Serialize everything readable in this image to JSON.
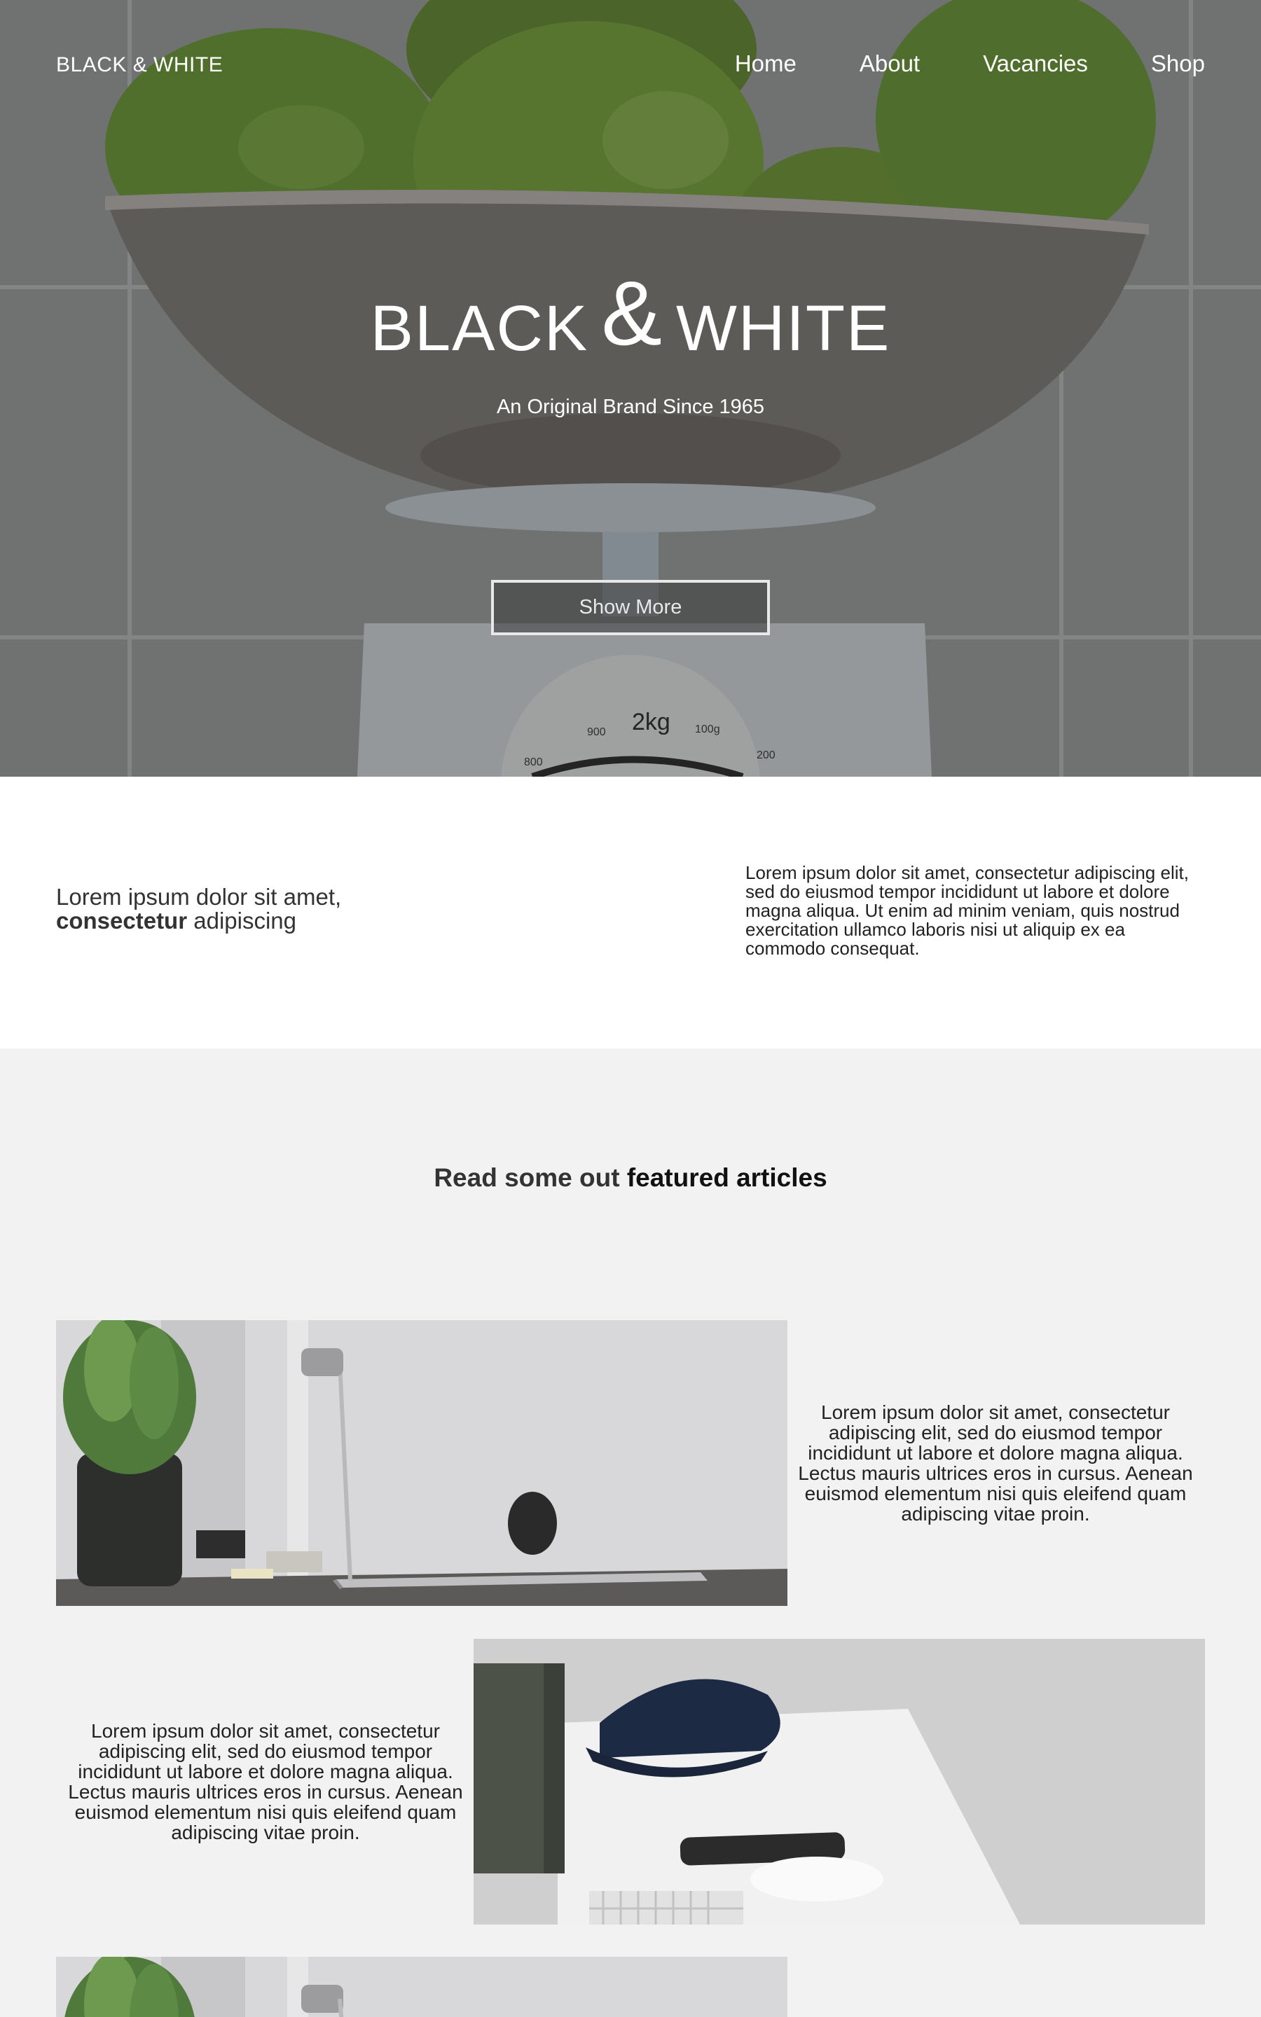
{
  "nav": {
    "brand": "BLACK & WHITE",
    "items": [
      {
        "label": "Home"
      },
      {
        "label": "About"
      },
      {
        "label": "Vacancies"
      },
      {
        "label": "Shop"
      }
    ]
  },
  "hero": {
    "title_left": "BLACK",
    "title_amp": "&",
    "title_right": "WHITE",
    "subtitle": "An Original Brand Since 1965",
    "button_label": "Show More",
    "scale_labels": [
      "900",
      "2kg",
      "100g",
      "800",
      "200"
    ]
  },
  "intro": {
    "left_line1": "Lorem ipsum dolor sit amet,",
    "left_bold": "consectetur",
    "left_rest": "adipiscing",
    "right_text": "Lorem ipsum dolor sit amet, consectetur adipiscing elit, sed do eiusmod tempor incididunt ut labore et dolore magna aliqua. Ut enim ad minim veniam, quis nostrud exercitation ullamco laboris nisi ut aliquip ex ea commodo consequat."
  },
  "featured": {
    "heading_plain": "Read some out",
    "heading_bold": "featured articles",
    "articles": [
      {
        "text": "Lorem ipsum dolor sit amet, consectetur adipiscing elit, sed do eiusmod tempor incididunt ut labore et dolore magna aliqua. Lectus mauris ultrices eros in cursus. Aenean euismod elementum nisi quis eleifend quam adipiscing vitae proin."
      },
      {
        "text": "Lorem ipsum dolor sit amet, consectetur adipiscing elit, sed do eiusmod tempor incididunt ut labore et dolore magna aliqua. Lectus mauris ultrices eros in cursus. Aenean euismod elementum nisi quis eleifend quam adipiscing vitae proin."
      }
    ]
  },
  "colors": {
    "page_bg": "#f2f2f2",
    "intro_bg": "#ffffff",
    "text": "#222222",
    "hero_text": "#ffffff"
  }
}
